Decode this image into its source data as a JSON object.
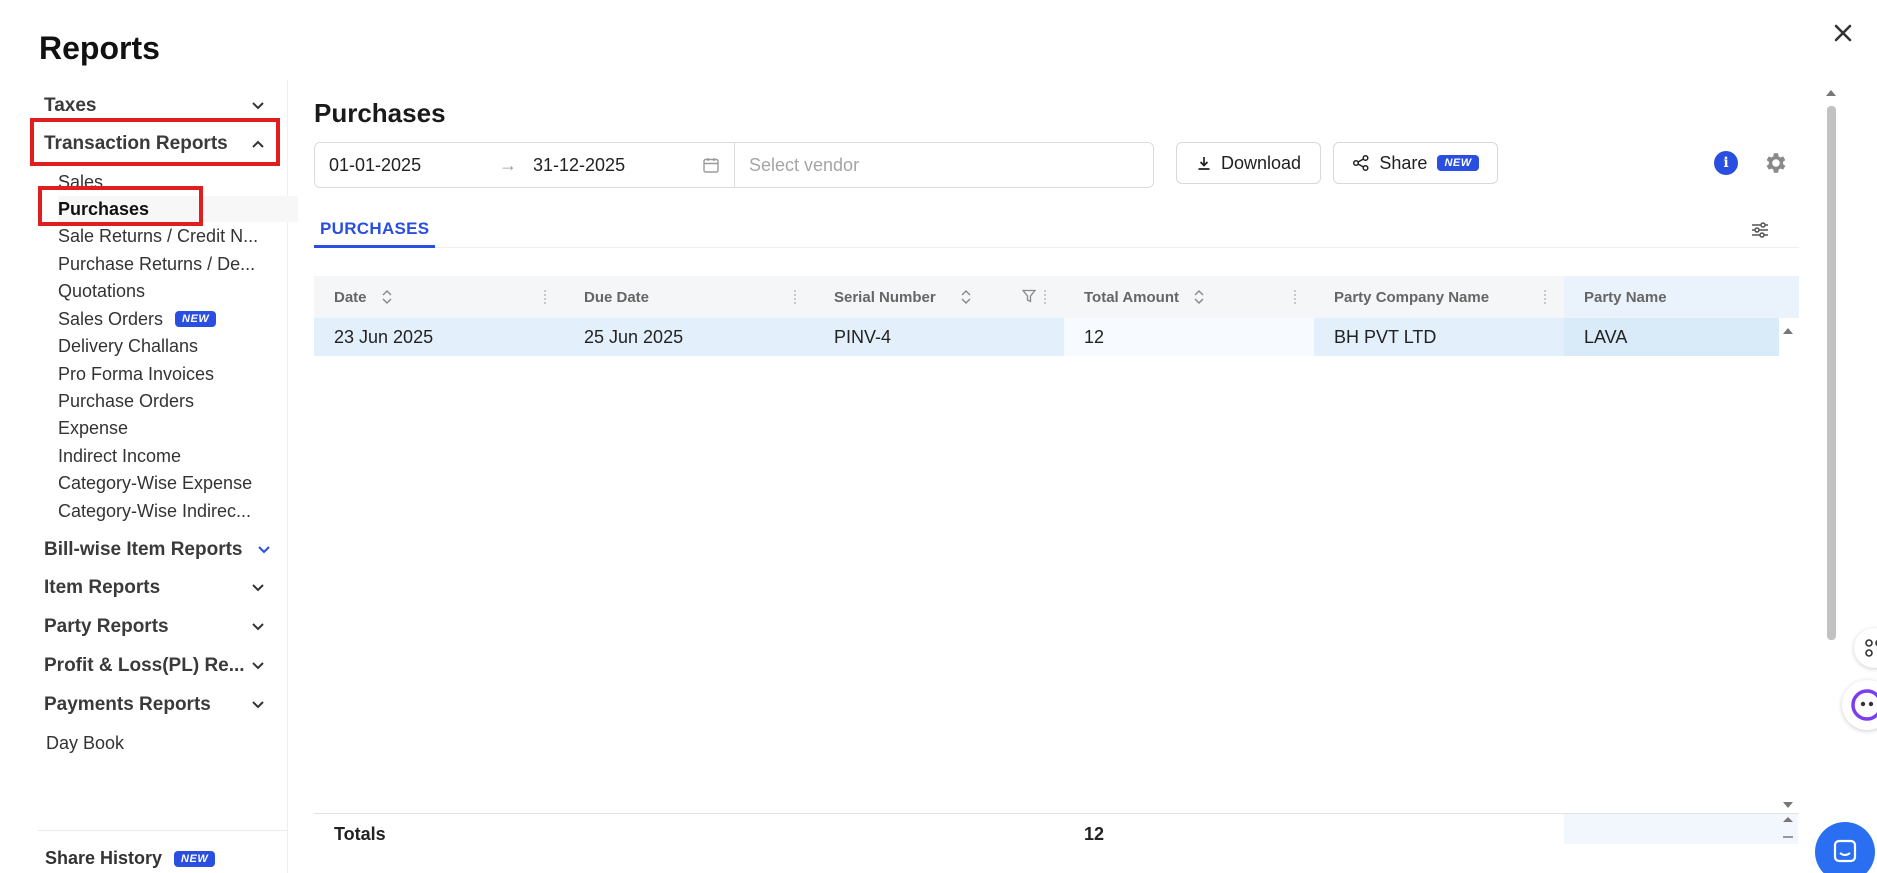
{
  "window": {
    "title": "Reports"
  },
  "sidebar": {
    "groups": {
      "taxes": "Taxes",
      "transaction_reports": "Transaction Reports",
      "bill_wise": "Bill-wise Item Reports",
      "item_reports": "Item Reports",
      "party_reports": "Party Reports",
      "profit_loss": "Profit & Loss(PL) Re...",
      "payments_reports": "Payments Reports",
      "day_book": "Day Book"
    },
    "transaction_items": [
      {
        "label": "Sales"
      },
      {
        "label": "Purchases"
      },
      {
        "label": "Sale Returns / Credit N..."
      },
      {
        "label": "Purchase Returns / De..."
      },
      {
        "label": "Quotations"
      },
      {
        "label": "Sales Orders",
        "badge": "NEW"
      },
      {
        "label": "Delivery Challans"
      },
      {
        "label": "Pro Forma Invoices"
      },
      {
        "label": "Purchase Orders"
      },
      {
        "label": "Expense"
      },
      {
        "label": "Indirect Income"
      },
      {
        "label": "Category-Wise Expense"
      },
      {
        "label": "Category-Wise Indirec..."
      }
    ],
    "share_history": {
      "label": "Share History",
      "badge": "NEW"
    }
  },
  "main": {
    "title": "Purchases",
    "filters": {
      "date_start": "01-01-2025",
      "date_end": "31-12-2025",
      "vendor_placeholder": "Select vendor",
      "vendor_value": ""
    },
    "toolbar": {
      "download_label": "Download",
      "share_label": "Share",
      "share_badge": "NEW",
      "info_glyph": "i"
    },
    "tabs": [
      {
        "label": "PURCHASES",
        "active": true
      }
    ],
    "table": {
      "columns": [
        "Date",
        "Due Date",
        "Serial Number",
        "Total Amount",
        "Party Company Name",
        "Party Name"
      ],
      "rows": [
        {
          "date": "23 Jun 2025",
          "due_date": "25 Jun 2025",
          "serial": "PINV-4",
          "total": "12",
          "company": "BH PVT LTD",
          "party": "LAVA"
        }
      ],
      "totals": {
        "label": "Totals",
        "total_amount": "12"
      }
    }
  },
  "colors": {
    "accent": "#2a4ee0",
    "highlight": "#e01e1e",
    "row_selected": "#e3f0fb",
    "chat_button": "#2a6ff1"
  },
  "icons": {
    "close": "close-icon",
    "chevron_down": "chevron-down-icon",
    "chevron_up": "chevron-up-icon",
    "calendar": "calendar-icon",
    "download": "download-icon",
    "share": "share-icon",
    "info": "info-icon",
    "gear": "gear-icon",
    "columns": "sliders-icon",
    "sort": "sort-icon",
    "filter": "filter-icon",
    "chat": "chat-icon"
  }
}
